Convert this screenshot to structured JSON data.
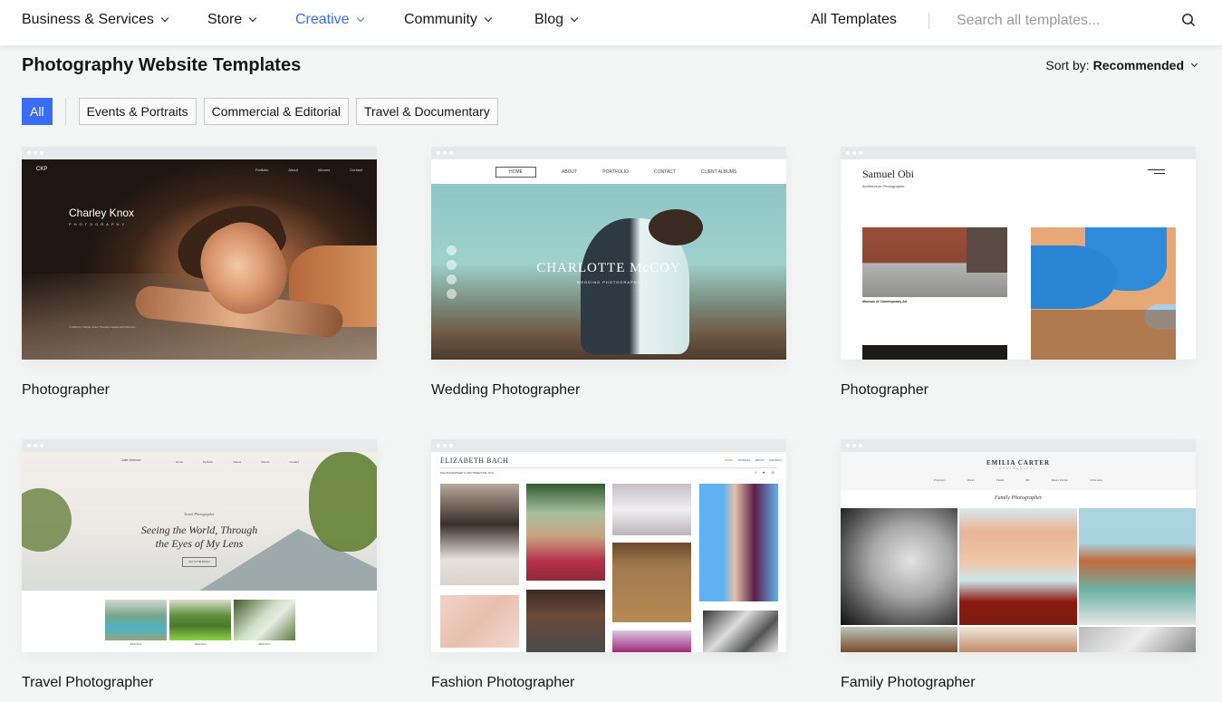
{
  "nav": {
    "items": [
      {
        "label": "Business & Services",
        "active": false
      },
      {
        "label": "Store",
        "active": false
      },
      {
        "label": "Creative",
        "active": true
      },
      {
        "label": "Community",
        "active": false
      },
      {
        "label": "Blog",
        "active": false
      }
    ],
    "all_templates": "All Templates",
    "search_placeholder": "Search all templates...",
    "accent_color": "#3b6cf6"
  },
  "header": {
    "title": "Photography Website Templates",
    "sort_label": "Sort by:",
    "sort_value": "Recommended"
  },
  "filters": [
    {
      "label": "All",
      "active": true
    },
    {
      "label": "Events & Portraits",
      "active": false
    },
    {
      "label": "Commercial & Editorial",
      "active": false
    },
    {
      "label": "Travel & Documentary",
      "active": false
    }
  ],
  "templates": [
    {
      "label": "Photographer",
      "preview": {
        "logo": "CKP",
        "menu": [
          "Portfolio",
          "About",
          "Albums",
          "Contact"
        ],
        "name": "Charley Knox",
        "subtitle": "PHOTOGRAPHY",
        "footer": "© 2023 by Charley Knox. Proudly created with Wix.com"
      }
    },
    {
      "label": "Wedding Photographer",
      "preview": {
        "menu": [
          "HOME",
          "ABOUT",
          "PORTFOLIO",
          "CONTACT",
          "CLIENT ALBUMS"
        ],
        "name": "CHARLOTTE McCOY",
        "subtitle": "WEDDING PHOTOGRAPHY"
      }
    },
    {
      "label": "Photographer",
      "preview": {
        "name": "Samuel Obi",
        "subtitle": "Architecture Photographer",
        "caption": "Museum of Contemporary Art"
      }
    },
    {
      "label": "Travel Photographer",
      "preview": {
        "logo": "Jake Johnson",
        "menu": [
          "Home",
          "Portfolio",
          "Videos",
          "Clients",
          "Contact"
        ],
        "kicker": "Travel Photographer",
        "headline": "Seeing the World, Through the Eyes of My Lens",
        "button": "GET IN THE BOOKS",
        "albums": [
          "Album No.1",
          "Album No.2",
          "Album No.3"
        ]
      }
    },
    {
      "label": "Fashion Photographer",
      "preview": {
        "name": "ELIZABETH BACH",
        "menu": [
          "WORK",
          "JOURNAL",
          "ABOUT",
          "CONTACT"
        ],
        "subtitle": "PHOTOGRAPHER & ART DIRECTOR, NYC",
        "social": "f ♥ ◎"
      }
    },
    {
      "label": "Family Photographer",
      "preview": {
        "name": "EMILIA CARTER",
        "subtitle": "PHOTOGRAPHY",
        "menu": [
          "Pregnancy",
          "Babies",
          "Family",
          "Bio",
          "Book a Session",
          "Client Area"
        ],
        "tagline": "Family Photographer"
      }
    }
  ]
}
